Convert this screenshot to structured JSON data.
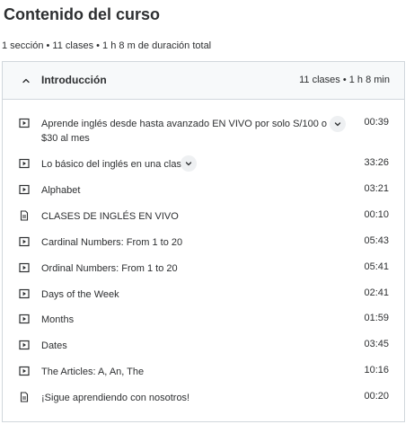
{
  "course_content": {
    "title": "Contenido del curso",
    "summary": "1 sección • 11 clases • 1 h 8 m de duración total"
  },
  "section": {
    "title": "Introducción",
    "meta": "11 clases • 1 h 8 min",
    "lectures": [
      {
        "icon": "video-icon",
        "title": "Aprende inglés desde hasta avanzado EN VIVO por solo S/100 o $30 al mes",
        "duration": "00:39",
        "expandable": true
      },
      {
        "icon": "video-icon",
        "title": "Lo básico del inglés en una clase",
        "duration": "33:26",
        "expandable": true
      },
      {
        "icon": "video-icon",
        "title": "Alphabet",
        "duration": "03:21",
        "expandable": false
      },
      {
        "icon": "document-icon",
        "title": "CLASES DE INGLÉS EN VIVO",
        "duration": "00:10",
        "expandable": false
      },
      {
        "icon": "video-icon",
        "title": "Cardinal Numbers: From 1 to 20",
        "duration": "05:43",
        "expandable": false
      },
      {
        "icon": "video-icon",
        "title": "Ordinal Numbers: From 1 to 20",
        "duration": "05:41",
        "expandable": false
      },
      {
        "icon": "video-icon",
        "title": "Days of the Week",
        "duration": "02:41",
        "expandable": false
      },
      {
        "icon": "video-icon",
        "title": "Months",
        "duration": "01:59",
        "expandable": false
      },
      {
        "icon": "video-icon",
        "title": "Dates",
        "duration": "03:45",
        "expandable": false
      },
      {
        "icon": "video-icon",
        "title": "The Articles: A, An, The",
        "duration": "10:16",
        "expandable": false
      },
      {
        "icon": "document-icon",
        "title": "¡Sigue aprendiendo con nosotros!",
        "duration": "00:20",
        "expandable": false
      }
    ]
  }
}
